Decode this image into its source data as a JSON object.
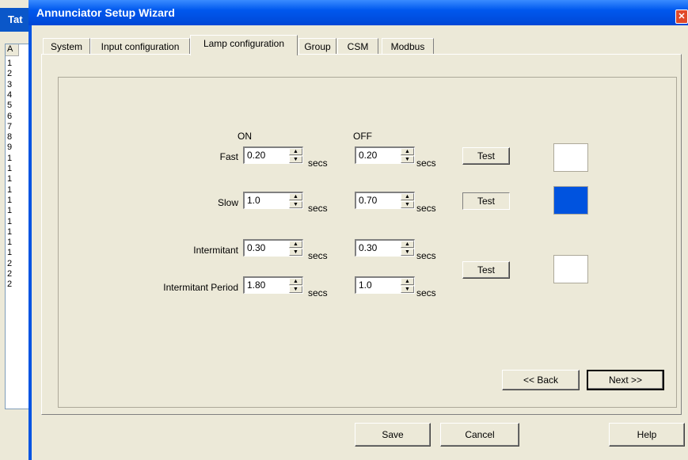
{
  "background_window": {
    "title": "Tat",
    "header": "A",
    "rows": [
      "1",
      "2",
      "3",
      "4",
      "5",
      "6",
      "7",
      "8",
      "9",
      "1",
      "1",
      "1",
      "1",
      "1",
      "1",
      "1",
      "1",
      "1",
      "1",
      "2",
      "2",
      "2"
    ]
  },
  "window": {
    "title": "Annunciator Setup Wizard",
    "close_icon": "close-icon"
  },
  "tabs": [
    {
      "label": "System",
      "active": false
    },
    {
      "label": "Input configuration",
      "active": false
    },
    {
      "label": "Lamp configuration",
      "active": true
    },
    {
      "label": "Group",
      "active": false
    },
    {
      "label": "CSM",
      "active": false
    },
    {
      "label": "Modbus",
      "active": false
    }
  ],
  "columns": {
    "on": "ON",
    "off": "OFF"
  },
  "unit": "secs",
  "rows": {
    "fast": {
      "label": "Fast",
      "on": "0.20",
      "off": "0.20"
    },
    "slow": {
      "label": "Slow",
      "on": "1.0",
      "off": "0.70"
    },
    "intermitant": {
      "label": "Intermitant",
      "on": "0.30",
      "off": "0.30"
    },
    "intermitant_period": {
      "label": "Intermitant Period",
      "on": "1.80",
      "off": "1.0"
    }
  },
  "test_buttons": {
    "fast": "Test",
    "slow": "Test",
    "intermitant": "Test"
  },
  "swatches": {
    "fast": "#ffffff",
    "slow": "#0053df",
    "intermitant": "#ffffff"
  },
  "nav": {
    "back": "<< Back",
    "next": "Next >>"
  },
  "footer": {
    "save": "Save",
    "cancel": "Cancel",
    "help": "Help"
  }
}
